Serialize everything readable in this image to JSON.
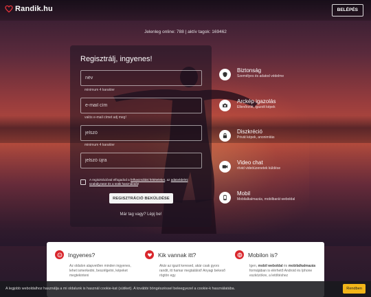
{
  "app": {
    "logo_text": "Randik.hu",
    "login_label": "BELÉPÉS"
  },
  "online_text": "Jelenleg online: 788 | aktív tagok: 169462",
  "register": {
    "title": "Regisztrálj, ingyenes!",
    "name_placeholder": "név",
    "name_hint": "minimum 4 karakter",
    "email_placeholder": "e-mail cím",
    "email_hint": "valós e-mail címet adj meg!",
    "password_placeholder": "jelszó",
    "password_hint": "minimum 4 karakter",
    "password2_placeholder": "jelszó újra",
    "terms_prefix": "A regisztrációval elfogadod a ",
    "terms_link1": "felhasználási feltételeket",
    "terms_mid": ", az ",
    "terms_link2": "adatvédelmi szabályzatot és a sütik használatát",
    "terms_suffix": "!",
    "submit_label": "REGISZTRÁCIÓ BEKÜLDÉSE",
    "member_link": "Már tag vagy? Lépj be!"
  },
  "features": [
    {
      "icon": "shield-icon",
      "title": "Biztonság",
      "desc": "Személyes és adatod védelme"
    },
    {
      "icon": "camera-icon",
      "title": "Arckép igazolás",
      "desc": "Ellenőrzött, igazolt képek"
    },
    {
      "icon": "lock-icon",
      "title": "Diszkréció",
      "desc": "Privát képek, anonimitás"
    },
    {
      "icon": "video-icon",
      "title": "Video chat",
      "desc": "rövid videóüzenetek küldése"
    },
    {
      "icon": "mobile-icon",
      "title": "Mobil",
      "desc": "Mobilalkalmazás, mobilbarát weboldal"
    }
  ],
  "info": {
    "col1": {
      "icon": "smile-icon",
      "title": "Ingyenes?",
      "text": "Az oldalon alapvetően minden ingyenes, lehet ismerkedni, beszélgetni, képeket megtekinteni"
    },
    "col2": {
      "icon": "heart-icon",
      "title": "Kik vannak itt?",
      "text": "Akár az igazit keresed, akár csak gyors randit, itt hamar megtalálod! Anyagi bekeső rögtön egy"
    },
    "col3": {
      "icon": "globe-icon",
      "title": "Mobilon is?",
      "text_prefix": "Igen, ",
      "bold1": "mobil weboldal",
      "text_mid": " és ",
      "bold2": "mobilalkalmazás",
      "text_suffix": " formájában is elérhető Android és Iphone eszközökre, a letöltéshez"
    }
  },
  "cookie": {
    "text": "A legjobb weboldalhoz használja a mi oldalunk is használ cookie-kat (sütiket). A további böngészéssel beleegyezel a cookie-k használatába.",
    "button_label": "Rendben"
  },
  "colors": {
    "brand_red": "#d9262c",
    "cookie_button": "#f2b619"
  }
}
